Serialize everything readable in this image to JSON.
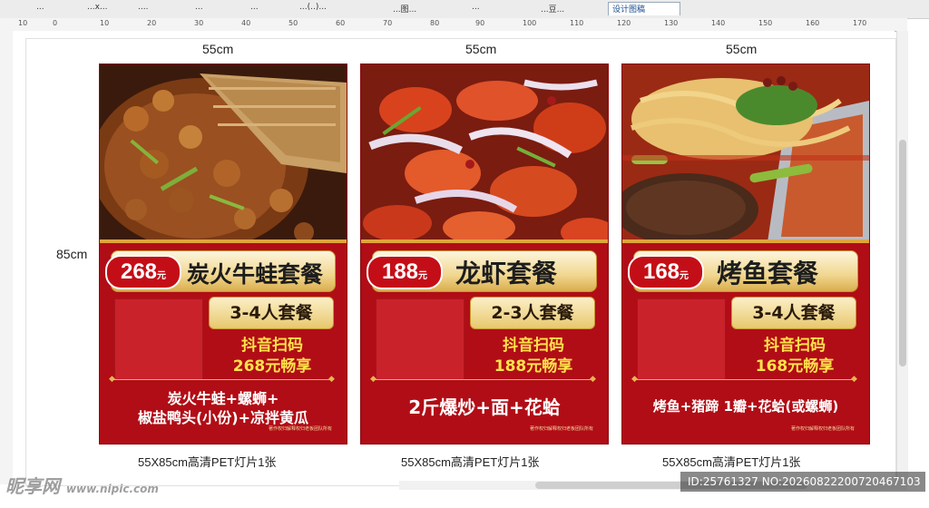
{
  "tabs": [
    {
      "label": "..."
    },
    {
      "label": "...x..."
    },
    {
      "label": "...."
    },
    {
      "label": "..."
    },
    {
      "label": "..."
    },
    {
      "label": "...(..)..."
    },
    {
      "label": "...图..."
    },
    {
      "label": "..."
    },
    {
      "label": "...豆..."
    },
    {
      "label": "设计图稿"
    }
  ],
  "ruler_top_numbers": [
    "10",
    "0",
    "10",
    "20",
    "30",
    "40",
    "50",
    "60",
    "70",
    "80",
    "90",
    "100",
    "110",
    "120",
    "130",
    "140",
    "150",
    "160",
    "170"
  ],
  "dimensions": {
    "width": "55cm",
    "height": "85cm"
  },
  "posters": [
    {
      "price": "268",
      "unit": "元",
      "title": "炭火牛蛙套餐",
      "people": "3-4人套餐",
      "scan_line1": "抖音扫码",
      "scan_line2": "268元畅享",
      "menu_line1": "炭火牛蛙+螺蛳+",
      "menu_line2": "椒盐鸭头(小份)+凉拌黄瓜",
      "copyright": "著作权归解释权归老板团队所有",
      "caption": "55X85cm高清PET灯片",
      "caption_count": "1张"
    },
    {
      "price": "188",
      "unit": "元",
      "title": "龙虾套餐",
      "people": "2-3人套餐",
      "scan_line1": "抖音扫码",
      "scan_line2": "188元畅享",
      "menu_line1": "2斤爆炒+面+花蛤",
      "menu_line2": "",
      "copyright": "著作权归解释权归老板团队所有",
      "caption": "55X85cm高清PET灯片",
      "caption_count": "1张"
    },
    {
      "price": "168",
      "unit": "元",
      "title": "烤鱼套餐",
      "people": "3-4人套餐",
      "scan_line1": "抖音扫码",
      "scan_line2": "168元畅享",
      "menu_line1": "烤鱼+猪蹄 1瓣+花蛤(或螺蛳)",
      "menu_line2": "",
      "copyright": "著作权归解释权归老板团队所有",
      "caption": "55X85cm高清PET灯片",
      "caption_count": "1张"
    }
  ],
  "watermark": {
    "brand": "昵享网",
    "url": "www.nipic.com",
    "id_text": "ID:25761327 NO:20260822200720467103"
  }
}
